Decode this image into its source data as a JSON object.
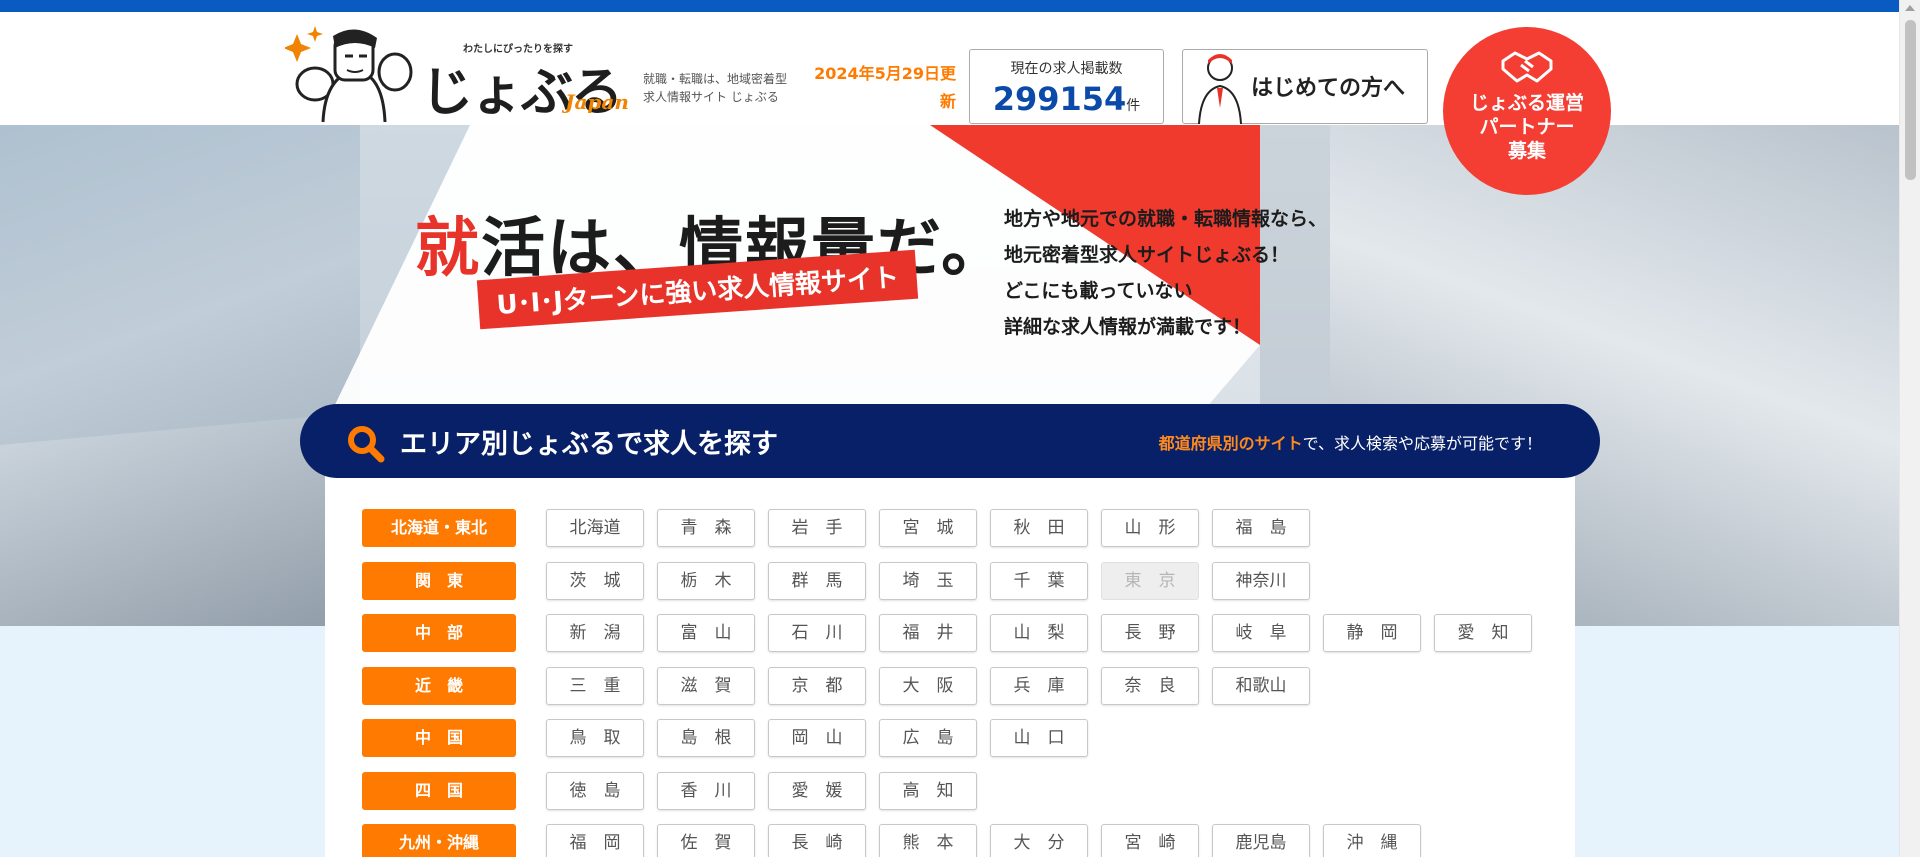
{
  "header": {
    "logo": {
      "tagline": "わたしにぴったりを探す",
      "wordmark": "じょぶる",
      "sub": "Japan"
    },
    "description_line1": "就職・転職は、地域密着型",
    "description_line2": "求人情報サイト じょぶる",
    "update_date": "2024年5月29日更新",
    "job_count": {
      "label": "現在の求人掲載数",
      "value": "299154",
      "unit": "件"
    },
    "first_time_button": "はじめての方へ",
    "partner_button": {
      "line1": "じょぶる運営",
      "line2": "パートナー",
      "line3": "募集"
    }
  },
  "hero": {
    "catch_red": "就",
    "catch_rest": "活は、情報量だ。",
    "catch_sub": "U･I･Jターンに強い求人情報サイト",
    "text_lines": [
      "地方や地元での就職・転職情報なら、",
      "地元密着型求人サイトじょぶる！",
      "どこにも載っていない",
      "詳細な求人情報が満載です！"
    ]
  },
  "area_search": {
    "title": "エリア別じょぶるで求人を探す",
    "note_highlight": "都道府県別のサイト",
    "note_rest": "で、求人検索や応募が可能です！",
    "regions": [
      {
        "label": "北海道・東北",
        "prefs": [
          "北海道",
          "青　森",
          "岩　手",
          "宮　城",
          "秋　田",
          "山　形",
          "福　島"
        ]
      },
      {
        "label": "関　東",
        "prefs": [
          "茨　城",
          "栃　木",
          "群　馬",
          "埼　玉",
          "千　葉",
          "東　京",
          "神奈川"
        ],
        "disabled": [
          "東　京"
        ]
      },
      {
        "label": "中　部",
        "prefs": [
          "新　潟",
          "富　山",
          "石　川",
          "福　井",
          "山　梨",
          "長　野",
          "岐　阜",
          "静　岡",
          "愛　知"
        ]
      },
      {
        "label": "近　畿",
        "prefs": [
          "三　重",
          "滋　賀",
          "京　都",
          "大　阪",
          "兵　庫",
          "奈　良",
          "和歌山"
        ]
      },
      {
        "label": "中　国",
        "prefs": [
          "鳥　取",
          "島　根",
          "岡　山",
          "広　島",
          "山　口"
        ]
      },
      {
        "label": "四　国",
        "prefs": [
          "徳　島",
          "香　川",
          "愛　媛",
          "高　知"
        ]
      },
      {
        "label": "九州・沖縄",
        "prefs": [
          "福　岡",
          "佐　賀",
          "長　崎",
          "熊　本",
          "大　分",
          "宮　崎",
          "鹿児島",
          "沖　縄"
        ]
      }
    ]
  },
  "colors": {
    "topbar": "#0a5bc1",
    "accent_orange": "#ff7a00",
    "partner_red": "#f43e33",
    "navy": "#082067"
  }
}
